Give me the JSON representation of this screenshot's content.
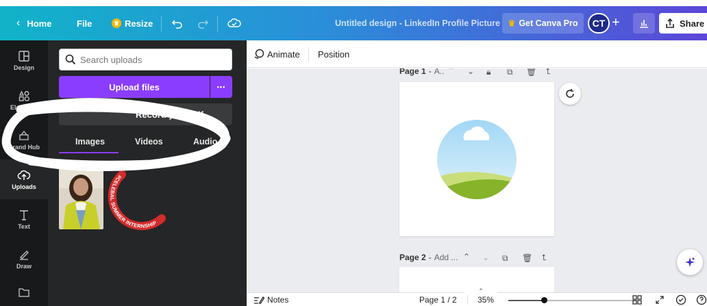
{
  "topbar": {
    "home_label": "Home",
    "file_label": "File",
    "resize_label": "Resize",
    "title": "Untitled design - LinkedIn Profile Picture",
    "pro_label": "Get Canva Pro",
    "avatar_initials": "CT",
    "share_label": "Share",
    "gradient_start": "#11b3c9",
    "gradient_end": "#5b47d8"
  },
  "rail": {
    "items": [
      {
        "label": "Design",
        "icon": "layout-icon"
      },
      {
        "label": "Elements",
        "icon": "shapes-icon"
      },
      {
        "label": "Brand Hub",
        "icon": "brand-icon"
      },
      {
        "label": "Uploads",
        "icon": "cloud-upload-icon"
      },
      {
        "label": "Text",
        "icon": "text-icon"
      },
      {
        "label": "Draw",
        "icon": "draw-icon"
      },
      {
        "label": "",
        "icon": "folder-icon"
      }
    ]
  },
  "panel": {
    "search_placeholder": "Search uploads",
    "upload_label": "Upload files",
    "more_label": "•••",
    "record_label": "Record yourself",
    "tabs": [
      "Images",
      "Videos",
      "Audio"
    ],
    "active_tab": "Images",
    "accent": "#8b3dff",
    "logo_text": "#CELEBAL SUMMER INTERNSHIP"
  },
  "editor": {
    "animate_label": "Animate",
    "position_label": "Position",
    "page1_label": "Page 1",
    "page1_title": "A..",
    "page2_label": "Page 2",
    "page2_title": "Add ..."
  },
  "footer": {
    "notes_label": "Notes",
    "page_indicator": "Page 1 / 2",
    "zoom": "35%"
  }
}
